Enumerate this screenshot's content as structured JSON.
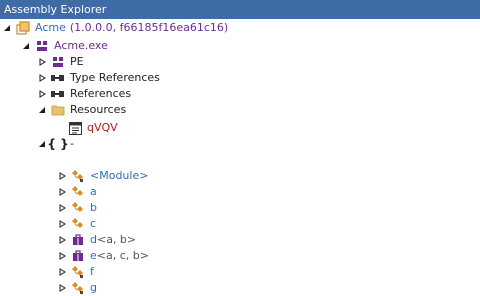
{
  "window": {
    "title": "Assembly Explorer"
  },
  "tree": {
    "root": {
      "name": "Acme",
      "details": "(1.0.0.0, f66185f16ea61c16)"
    },
    "module": {
      "name": "Acme.exe"
    },
    "pe": "PE",
    "type_references": "Type References",
    "references": "References",
    "resources": "Resources",
    "resource_item": "qVQV",
    "namespace": "-",
    "types": [
      {
        "name": "<Module>",
        "generic": ""
      },
      {
        "name": "a",
        "generic": ""
      },
      {
        "name": "b",
        "generic": ""
      },
      {
        "name": "c",
        "generic": ""
      },
      {
        "name": "d",
        "generic": "<a, b>"
      },
      {
        "name": "e",
        "generic": "<a, c, b>"
      },
      {
        "name": "f",
        "generic": ""
      },
      {
        "name": "g",
        "generic": ""
      }
    ]
  }
}
